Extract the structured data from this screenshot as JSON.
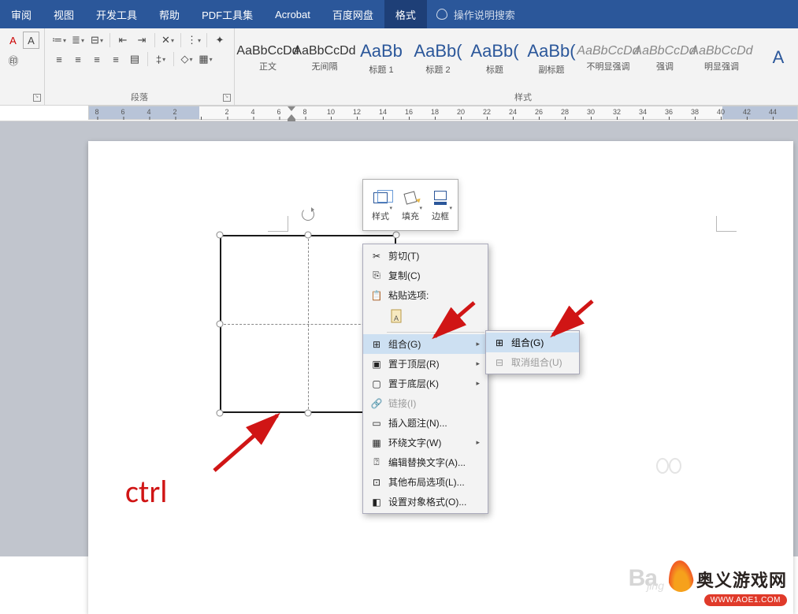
{
  "tabs": {
    "review": "审阅",
    "view": "视图",
    "dev": "开发工具",
    "help": "帮助",
    "pdf": "PDF工具集",
    "acrobat": "Acrobat",
    "baidu": "百度网盘",
    "format": "格式",
    "tellme": "操作说明搜索"
  },
  "groups": {
    "paragraph": "段落",
    "styles": "样式"
  },
  "styles": [
    {
      "sample": "AaBbCcDd",
      "name": "正文",
      "cls": ""
    },
    {
      "sample": "AaBbCcDd",
      "name": "无间隔",
      "cls": ""
    },
    {
      "sample": "AaBb",
      "name": "标题 1",
      "cls": "big"
    },
    {
      "sample": "AaBb(",
      "name": "标题 2",
      "cls": "big"
    },
    {
      "sample": "AaBb(",
      "name": "标题",
      "cls": "big"
    },
    {
      "sample": "AaBb(",
      "name": "副标题",
      "cls": "big"
    },
    {
      "sample": "AaBbCcDd",
      "name": "不明显强调",
      "cls": "faded"
    },
    {
      "sample": "AaBbCcDd",
      "name": "强调",
      "cls": "faded"
    },
    {
      "sample": "AaBbCcDd",
      "name": "明显强调",
      "cls": "faded"
    },
    {
      "sample": "A",
      "name": "",
      "cls": "big"
    }
  ],
  "mini": {
    "style": "样式",
    "fill": "填充",
    "outline": "边框"
  },
  "ctx": {
    "cut": "剪切(T)",
    "copy": "复制(C)",
    "paste_header": "粘贴选项:",
    "group": "组合(G)",
    "bring_front": "置于顶层(R)",
    "send_back": "置于底层(K)",
    "link": "链接(I)",
    "insert_caption": "插入题注(N)...",
    "wrap_text": "环绕文字(W)",
    "alt_text": "编辑替换文字(A)...",
    "more_layout": "其他布局选项(L)...",
    "format_object": "设置对象格式(O)..."
  },
  "sub": {
    "group": "组合(G)",
    "ungroup": "取消组合(U)"
  },
  "ruler_ticks": [
    "8",
    "6",
    "4",
    "2",
    "",
    "2",
    "4",
    "6",
    "8",
    "10",
    "12",
    "14",
    "16",
    "18",
    "20",
    "22",
    "24",
    "26",
    "28",
    "30",
    "32",
    "34",
    "36",
    "38",
    "40",
    "42",
    "44"
  ],
  "annotation": {
    "ctrl": "ctrl"
  },
  "watermark": {
    "ba": "Ba",
    "jing": "jīng",
    "site": "奥义游戏网",
    "url": "WWW.AOE1.COM"
  }
}
